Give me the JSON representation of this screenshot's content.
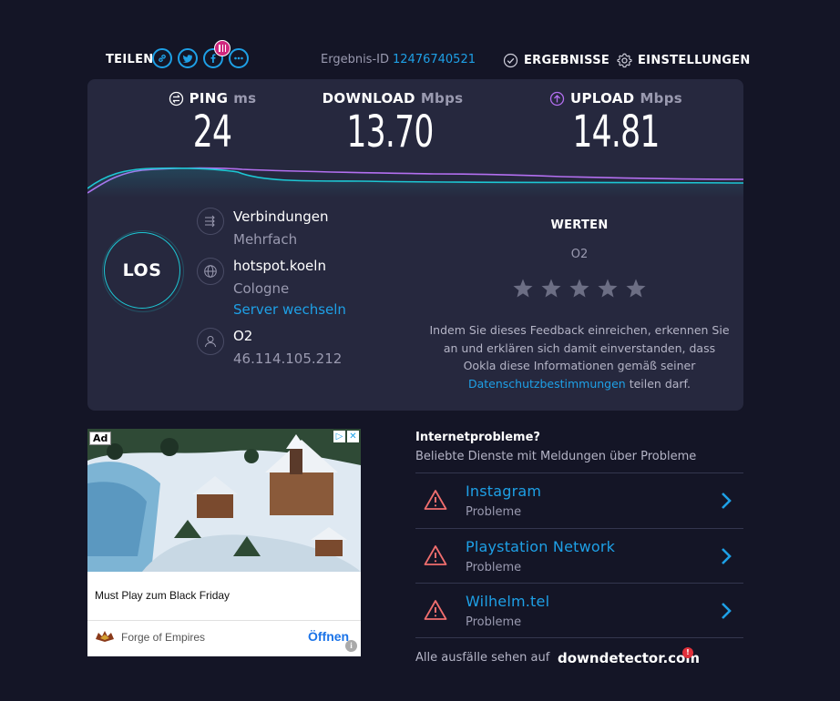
{
  "share": {
    "label": "TEILEN",
    "icons": [
      "link-icon",
      "twitter-icon",
      "facebook-icon",
      "more-icon"
    ]
  },
  "result": {
    "id_label": "Ergebnis-ID",
    "id_value": "12476740521"
  },
  "nav": {
    "results": "ERGEBNISSE",
    "settings": "EINSTELLUNGEN"
  },
  "metrics": {
    "ping": {
      "label": "PING",
      "unit": "ms",
      "value": "24"
    },
    "download": {
      "label": "DOWNLOAD",
      "unit": "Mbps",
      "value": "13.70"
    },
    "upload": {
      "label": "UPLOAD",
      "unit": "Mbps",
      "value": "14.81"
    }
  },
  "go_button": "LOS",
  "connections": {
    "title": "Verbindungen",
    "value": "Mehrfach"
  },
  "server": {
    "name": "hotspot.koeln",
    "location": "Cologne",
    "change_link": "Server wechseln"
  },
  "isp": {
    "name": "O2",
    "ip": "46.114.105.212"
  },
  "rating": {
    "title": "WERTEN",
    "isp": "O2",
    "stars": 5,
    "note": "Indem Sie dieses Feedback einreichen, erkennen Sie an und erklären sich damit einverstanden, dass Ookla diese Informationen gemäß seiner",
    "privacy_link": "Datenschutzbestimmungen",
    "note_end": "teilen darf."
  },
  "ad": {
    "badge": "Ad",
    "headline": "Must Play zum Black Friday",
    "brand": "Forge of Empires",
    "cta": "Öffnen",
    "info": "i"
  },
  "outages": {
    "title": "Internetprobleme?",
    "subtitle": "Beliebte Dienste mit Meldungen über Probleme",
    "items": [
      {
        "name": "Instagram",
        "status": "Probleme"
      },
      {
        "name": "Playstation Network",
        "status": "Probleme"
      },
      {
        "name": "Wilhelm.tel",
        "status": "Probleme"
      }
    ],
    "footer_text": "Alle ausfälle sehen auf",
    "footer_brand": "downdetector.com",
    "footer_badge": "!"
  },
  "colors": {
    "background": "#141526",
    "panel": "#26283e",
    "accent_blue": "#1ea0e6",
    "download_cyan": "#1dc7d4",
    "upload_purple": "#b36ff0",
    "warning_red": "#f06e6e"
  }
}
